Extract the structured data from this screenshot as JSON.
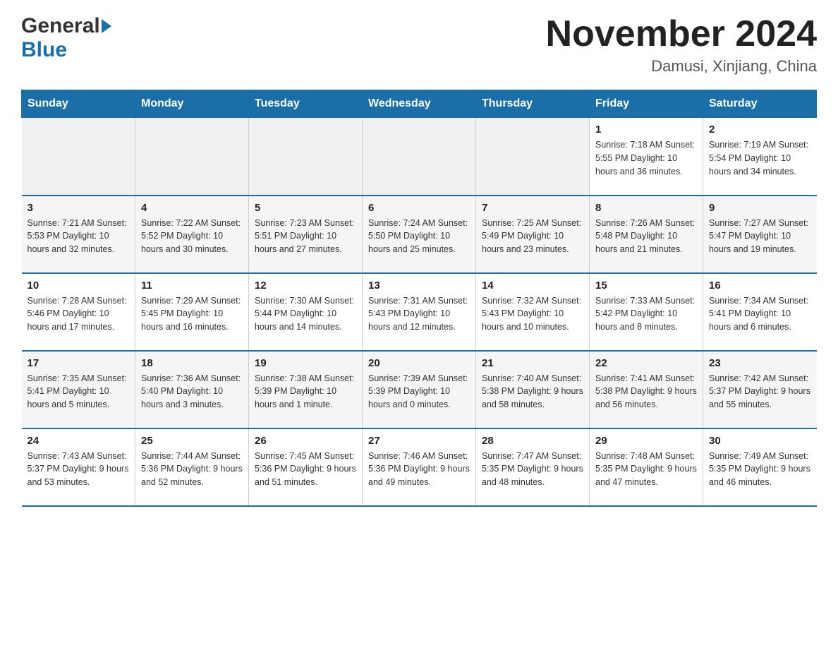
{
  "header": {
    "logo_line1": "General",
    "logo_line2": "Blue",
    "month_title": "November 2024",
    "location": "Damusi, Xinjiang, China"
  },
  "weekdays": [
    "Sunday",
    "Monday",
    "Tuesday",
    "Wednesday",
    "Thursday",
    "Friday",
    "Saturday"
  ],
  "weeks": [
    [
      {
        "day": "",
        "info": ""
      },
      {
        "day": "",
        "info": ""
      },
      {
        "day": "",
        "info": ""
      },
      {
        "day": "",
        "info": ""
      },
      {
        "day": "",
        "info": ""
      },
      {
        "day": "1",
        "info": "Sunrise: 7:18 AM\nSunset: 5:55 PM\nDaylight: 10 hours and 36 minutes."
      },
      {
        "day": "2",
        "info": "Sunrise: 7:19 AM\nSunset: 5:54 PM\nDaylight: 10 hours and 34 minutes."
      }
    ],
    [
      {
        "day": "3",
        "info": "Sunrise: 7:21 AM\nSunset: 5:53 PM\nDaylight: 10 hours and 32 minutes."
      },
      {
        "day": "4",
        "info": "Sunrise: 7:22 AM\nSunset: 5:52 PM\nDaylight: 10 hours and 30 minutes."
      },
      {
        "day": "5",
        "info": "Sunrise: 7:23 AM\nSunset: 5:51 PM\nDaylight: 10 hours and 27 minutes."
      },
      {
        "day": "6",
        "info": "Sunrise: 7:24 AM\nSunset: 5:50 PM\nDaylight: 10 hours and 25 minutes."
      },
      {
        "day": "7",
        "info": "Sunrise: 7:25 AM\nSunset: 5:49 PM\nDaylight: 10 hours and 23 minutes."
      },
      {
        "day": "8",
        "info": "Sunrise: 7:26 AM\nSunset: 5:48 PM\nDaylight: 10 hours and 21 minutes."
      },
      {
        "day": "9",
        "info": "Sunrise: 7:27 AM\nSunset: 5:47 PM\nDaylight: 10 hours and 19 minutes."
      }
    ],
    [
      {
        "day": "10",
        "info": "Sunrise: 7:28 AM\nSunset: 5:46 PM\nDaylight: 10 hours and 17 minutes."
      },
      {
        "day": "11",
        "info": "Sunrise: 7:29 AM\nSunset: 5:45 PM\nDaylight: 10 hours and 16 minutes."
      },
      {
        "day": "12",
        "info": "Sunrise: 7:30 AM\nSunset: 5:44 PM\nDaylight: 10 hours and 14 minutes."
      },
      {
        "day": "13",
        "info": "Sunrise: 7:31 AM\nSunset: 5:43 PM\nDaylight: 10 hours and 12 minutes."
      },
      {
        "day": "14",
        "info": "Sunrise: 7:32 AM\nSunset: 5:43 PM\nDaylight: 10 hours and 10 minutes."
      },
      {
        "day": "15",
        "info": "Sunrise: 7:33 AM\nSunset: 5:42 PM\nDaylight: 10 hours and 8 minutes."
      },
      {
        "day": "16",
        "info": "Sunrise: 7:34 AM\nSunset: 5:41 PM\nDaylight: 10 hours and 6 minutes."
      }
    ],
    [
      {
        "day": "17",
        "info": "Sunrise: 7:35 AM\nSunset: 5:41 PM\nDaylight: 10 hours and 5 minutes."
      },
      {
        "day": "18",
        "info": "Sunrise: 7:36 AM\nSunset: 5:40 PM\nDaylight: 10 hours and 3 minutes."
      },
      {
        "day": "19",
        "info": "Sunrise: 7:38 AM\nSunset: 5:39 PM\nDaylight: 10 hours and 1 minute."
      },
      {
        "day": "20",
        "info": "Sunrise: 7:39 AM\nSunset: 5:39 PM\nDaylight: 10 hours and 0 minutes."
      },
      {
        "day": "21",
        "info": "Sunrise: 7:40 AM\nSunset: 5:38 PM\nDaylight: 9 hours and 58 minutes."
      },
      {
        "day": "22",
        "info": "Sunrise: 7:41 AM\nSunset: 5:38 PM\nDaylight: 9 hours and 56 minutes."
      },
      {
        "day": "23",
        "info": "Sunrise: 7:42 AM\nSunset: 5:37 PM\nDaylight: 9 hours and 55 minutes."
      }
    ],
    [
      {
        "day": "24",
        "info": "Sunrise: 7:43 AM\nSunset: 5:37 PM\nDaylight: 9 hours and 53 minutes."
      },
      {
        "day": "25",
        "info": "Sunrise: 7:44 AM\nSunset: 5:36 PM\nDaylight: 9 hours and 52 minutes."
      },
      {
        "day": "26",
        "info": "Sunrise: 7:45 AM\nSunset: 5:36 PM\nDaylight: 9 hours and 51 minutes."
      },
      {
        "day": "27",
        "info": "Sunrise: 7:46 AM\nSunset: 5:36 PM\nDaylight: 9 hours and 49 minutes."
      },
      {
        "day": "28",
        "info": "Sunrise: 7:47 AM\nSunset: 5:35 PM\nDaylight: 9 hours and 48 minutes."
      },
      {
        "day": "29",
        "info": "Sunrise: 7:48 AM\nSunset: 5:35 PM\nDaylight: 9 hours and 47 minutes."
      },
      {
        "day": "30",
        "info": "Sunrise: 7:49 AM\nSunset: 5:35 PM\nDaylight: 9 hours and 46 minutes."
      }
    ]
  ]
}
